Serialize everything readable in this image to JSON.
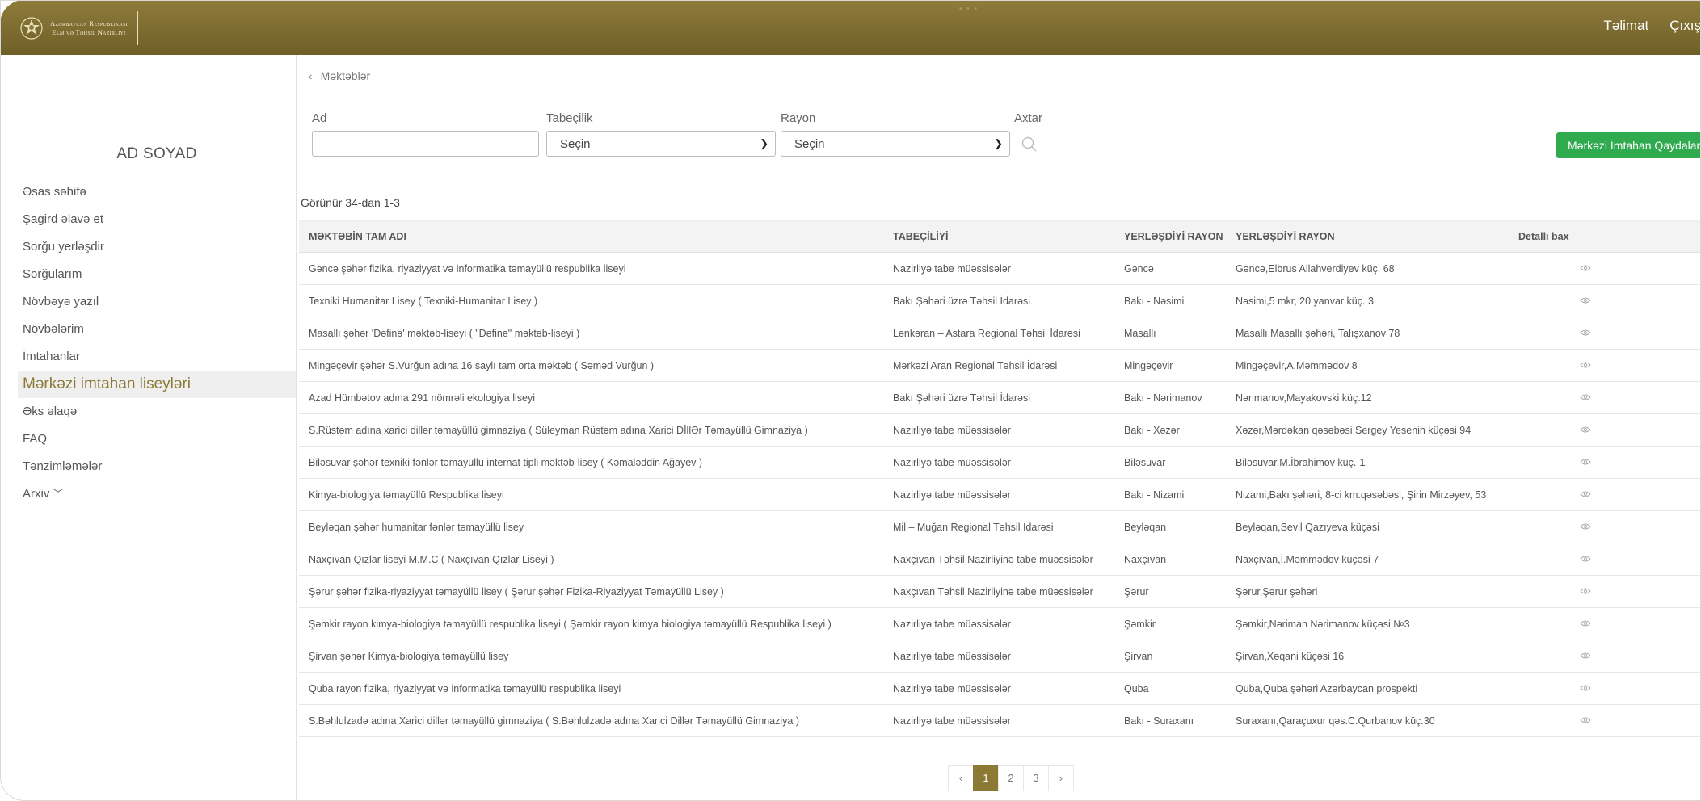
{
  "header": {
    "logo_line1": "Azərbaycan Respublikası",
    "logo_line2": "Elm və Təhsil Nazirliyi",
    "watermark": "...",
    "links": {
      "guide": "Təlimat",
      "logout": "Çıxış"
    }
  },
  "sidebar": {
    "user_name": "AD SOYAD",
    "items": [
      {
        "label": "Əsas səhifə",
        "active": false
      },
      {
        "label": "Şagird əlavə et",
        "active": false
      },
      {
        "label": "Sorğu yerləşdir",
        "active": false
      },
      {
        "label": "Sorğularım",
        "active": false
      },
      {
        "label": "Növbəyə yazıl",
        "active": false
      },
      {
        "label": "Növbələrim",
        "active": false
      },
      {
        "label": "İmtahanlar",
        "active": false
      },
      {
        "label": "Mərkəzi imtahan liseyləri",
        "active": true
      },
      {
        "label": "Əks əlaqə",
        "active": false
      },
      {
        "label": "FAQ",
        "active": false
      },
      {
        "label": "Tənzimləmələr",
        "active": false
      },
      {
        "label": "Arxiv",
        "active": false
      }
    ]
  },
  "breadcrumb": "Məktəblər",
  "filters": {
    "name_label": "Ad",
    "name_value": "",
    "subordination_label": "Tabeçilik",
    "subordination_value": "Seçin",
    "district_label": "Rayon",
    "district_value": "Seçin",
    "search_label": "Axtar"
  },
  "rules_button": "Mərkəzi İmtahan Qaydaları",
  "count_text": "Görünür 34-dan 1-3",
  "table": {
    "headers": [
      "MƏKTƏBİN TAM ADI",
      "TABEÇİLİYİ",
      "YERLƏŞDİYİ RAYON",
      "YERLƏŞDİYİ RAYON",
      "Detallı bax"
    ],
    "rows": [
      [
        "Gəncə şəhər fizika, riyaziyyat və informatika təmayüllü respublika liseyi",
        "Nazirliyə tabe müəssisələr",
        "Gəncə",
        "Gəncə,Elbrus Allahverdiyev küç. 68"
      ],
      [
        "Texniki Humanitar Lisey ( Texniki-Humanitar Lisey )",
        "Bakı Şəhəri üzrə Təhsil İdarəsi",
        "Bakı - Nəsimi",
        "Nəsimi,5 mkr, 20 yanvar küç. 3"
      ],
      [
        "Masallı şəhər 'Dəfinə' məktəb-liseyi ( \"Dəfinə\" məktəb-liseyi )",
        "Lənkəran – Astara Regional Təhsil İdarəsi",
        "Masallı",
        "Masallı,Masallı şəhəri, Talışxanov 78"
      ],
      [
        "Mingəçevir şəhər S.Vurğun adına 16 saylı tam orta məktəb ( Səməd Vurğun )",
        "Mərkəzi Aran Regional Təhsil İdarəsi",
        "Mingəçevir",
        "Mingəçevir,A.Məmmədov 8"
      ],
      [
        "Azad Hümbətov adına 291 nömrəli ekologiya liseyi",
        "Bakı Şəhəri üzrə Təhsil İdarəsi",
        "Bakı - Nərimanov",
        "Nərimanov,Mayakovski küç.12"
      ],
      [
        "S.Rüstəm adına xarici dillər təmayüllü gimnaziya ( Süleyman Rüstəm adına Xarici DİllƏr Təmayüllü Gimnaziya )",
        "Nazirliyə tabe müəssisələr",
        "Bakı - Xəzər",
        "Xəzər,Mərdəkan qəsəbəsi Sergey Yesenin küçəsi 94"
      ],
      [
        "Biləsuvar şəhər texniki fənlər təmayüllü internat tipli məktəb-lisey ( Kəmaləddin Ağayev )",
        "Nazirliyə tabe müəssisələr",
        "Biləsuvar",
        "Biləsuvar,M.İbrahimov küç.-1"
      ],
      [
        "Kimya-biologiya təmayüllü Respublika liseyi",
        "Nazirliyə tabe müəssisələr",
        "Bakı - Nizami",
        "Nizami,Bakı şəhəri, 8-ci km.qəsəbəsi, Şirin Mirzəyev, 53"
      ],
      [
        "Beyləqan şəhər humanitar fənlər təmayüllü lisey",
        "Mil – Muğan Regional Təhsil İdarəsi",
        "Beyləqan",
        "Beyləqan,Sevil Qazıyeva küçəsi"
      ],
      [
        "Naxçıvan Qızlar liseyi M.M.C ( Naxçıvan Qızlar Liseyi )",
        "Naxçıvan Təhsil Nazirliyinə tabe müəssisələr",
        "Naxçıvan",
        "Naxçıvan,İ.Məmmədov küçəsi 7"
      ],
      [
        "Şərur şəhər fizika-riyaziyyat təmayüllü lisey ( Şərur şəhər Fizika-Riyaziyyat Təmayüllü Lisey )",
        "Naxçıvan Təhsil Nazirliyinə tabe müəssisələr",
        "Şərur",
        "Şərur,Şərur şəhəri"
      ],
      [
        "Şəmkir rayon kimya-biologiya təmayüllü respublika liseyi ( Şəmkir rayon kimya biologiya təmayüllü Respublika liseyi )",
        "Nazirliyə tabe müəssisələr",
        "Şəmkir",
        "Şəmkir,Nəriman Nərimanov küçəsi №3"
      ],
      [
        "Şirvan şəhər Kimya-biologiya təmayüllü lisey",
        "Nazirliyə tabe müəssisələr",
        "Şirvan",
        "Şirvan,Xəqani küçəsi 16"
      ],
      [
        "Quba rayon fizika, riyaziyyat və informatika təmayüllü respublika liseyi",
        "Nazirliyə tabe müəssisələr",
        "Quba",
        "Quba,Quba şəhəri Azərbaycan prospekti"
      ],
      [
        "S.Bəhlulzadə adına Xarici dillər təmayüllü gimnaziya ( S.Bəhlulzadə adına Xarici Dillər Təmayüllü Gimnaziya )",
        "Nazirliyə tabe müəssisələr",
        "Bakı - Suraxanı",
        "Suraxanı,Qaraçuxur qəs.C.Qurbanov küç.30"
      ]
    ]
  },
  "pagination": {
    "prev": "‹",
    "next": "›",
    "pages": [
      "1",
      "2",
      "3"
    ],
    "current": "1"
  },
  "colors": {
    "brand": "#8c7a34",
    "header": "#7a6a2f",
    "green": "#2faa4e"
  },
  "icons": [
    "emblem-icon",
    "chevron-left-icon",
    "search-icon",
    "chevron-down-icon",
    "eye-icon"
  ]
}
